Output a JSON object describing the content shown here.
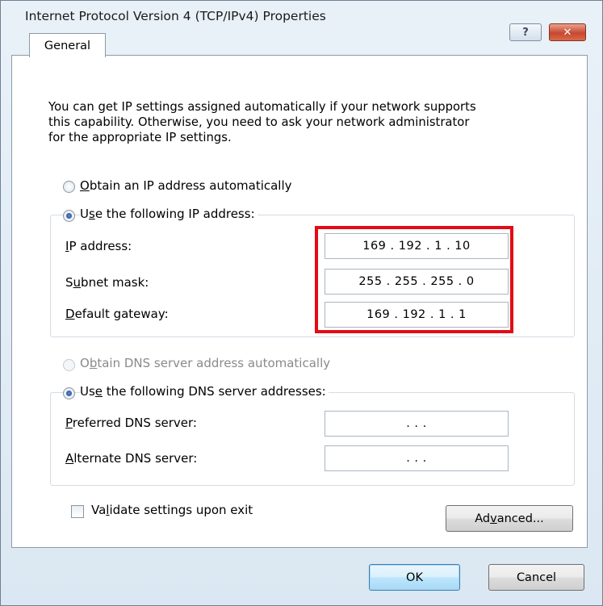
{
  "window": {
    "title": "Internet Protocol Version 4 (TCP/IPv4) Properties"
  },
  "titlebar_buttons": {
    "help_glyph": "?",
    "close_glyph": "✕"
  },
  "tabs": [
    {
      "label": "General"
    }
  ],
  "intro_text": "You can get IP settings assigned automatically if your network supports\nthis capability. Otherwise, you need to ask your network administrator\nfor the appropriate IP settings.",
  "ip_mode": {
    "auto": {
      "pre": "",
      "mnemonic": "O",
      "post": "btain an IP address automatically",
      "selected": false
    },
    "manual": {
      "pre": "U",
      "mnemonic": "s",
      "post": "e the following IP address:",
      "selected": true
    }
  },
  "ip_fields": [
    {
      "pre": "",
      "mnemonic": "I",
      "post": "P address:",
      "value": "169 . 192 .  1  .  10"
    },
    {
      "pre": "S",
      "mnemonic": "u",
      "post": "bnet mask:",
      "value": "255 . 255 . 255 .  0"
    },
    {
      "pre": "",
      "mnemonic": "D",
      "post": "efault gateway:",
      "value": "169 . 192 .  1  .  1"
    }
  ],
  "dns_mode": {
    "auto": {
      "pre": "O",
      "mnemonic": "b",
      "post": "tain DNS server address automatically",
      "selected": false,
      "disabled": true
    },
    "manual": {
      "pre": "Us",
      "mnemonic": "e",
      "post": " the following DNS server addresses:",
      "selected": true
    }
  },
  "dns_fields": [
    {
      "pre": "",
      "mnemonic": "P",
      "post": "referred DNS server:",
      "value": ".       .       ."
    },
    {
      "pre": "",
      "mnemonic": "A",
      "post": "lternate DNS server:",
      "value": ".       .       ."
    }
  ],
  "validate": {
    "pre": "Va",
    "mnemonic": "l",
    "post": "idate settings upon exit",
    "checked": false
  },
  "buttons": {
    "advanced": {
      "pre": "Ad",
      "mnemonic": "v",
      "post": "anced..."
    },
    "ok": "OK",
    "cancel": "Cancel"
  },
  "colors": {
    "highlight": "#e30b14",
    "window_bg": "#dbe7f2"
  }
}
